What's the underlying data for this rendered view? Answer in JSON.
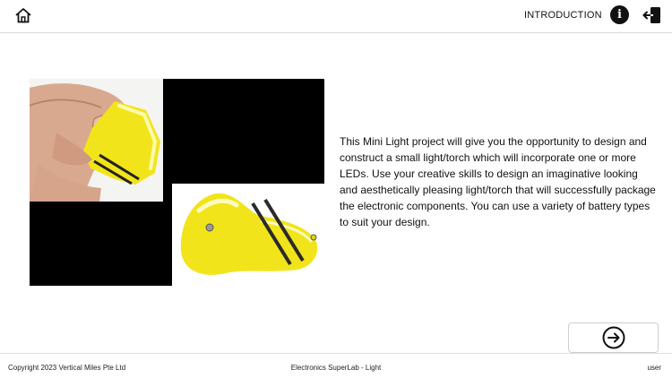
{
  "header": {
    "home_icon": "home-icon",
    "title": "INTRODUCTION",
    "info_label": "i",
    "info_icon": "info-icon",
    "exit_icon": "exit-icon"
  },
  "media": {
    "images": [
      "hand-holding-yellow-torch-photo",
      "yellow-torch-closeup-photo"
    ],
    "accent_colors": {
      "torch_yellow": "#f2e41a",
      "background": "#000000"
    }
  },
  "content": {
    "description": "This Mini Light project will give you the opportunity to design and construct a small light/torch which will incorporate one or more LEDs. Use your creative skills to design an imaginative looking and aesthetically pleasing light/torch that will successfully package the electronic components. You can use a variety of battery types to suit your design."
  },
  "navigation": {
    "next_icon": "arrow-right-circle-icon"
  },
  "footer": {
    "copyright": "Copyright 2023 Vertical Miles Pte Ltd",
    "app_name": "Electronics SuperLab - Light",
    "user": "user"
  }
}
